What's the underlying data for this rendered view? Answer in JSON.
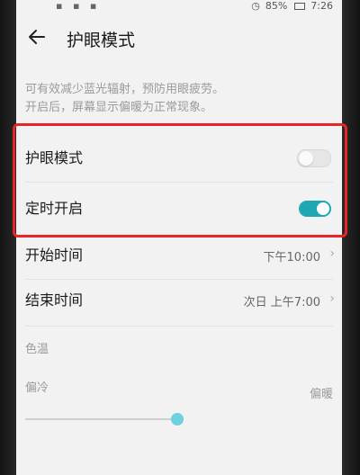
{
  "status_bar": {
    "battery": "85%",
    "time": "7:26"
  },
  "header": {
    "title": "护眼模式",
    "back_icon": "arrow-left-icon"
  },
  "description": {
    "line1": "可有效减少蓝光辐射，预防用眼疲劳。",
    "line2": "开启后，屏幕显示偏暖为正常现象。"
  },
  "settings": {
    "eye_comfort": {
      "label": "护眼模式",
      "enabled": false
    },
    "scheduled": {
      "label": "定时开启",
      "enabled": true
    },
    "start_time": {
      "label": "开始时间",
      "value": "下午10:00"
    },
    "end_time": {
      "label": "结束时间",
      "value": "次日 上午7:00"
    }
  },
  "color_temperature": {
    "label": "色温",
    "cool_label": "偏冷",
    "warm_label": "偏暖",
    "level": 0.52
  },
  "colors": {
    "accent": "#1fa7b3",
    "highlight": "#e8262a"
  }
}
